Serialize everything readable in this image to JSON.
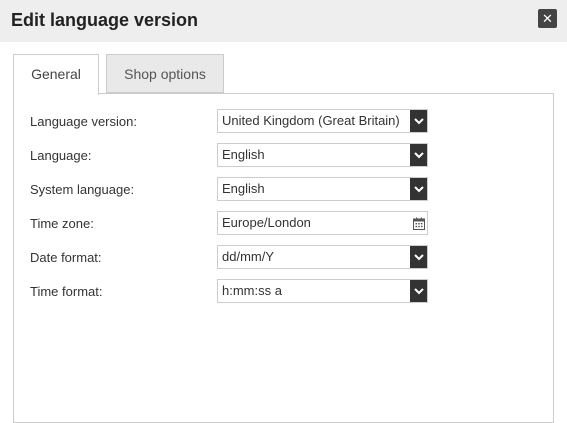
{
  "dialog": {
    "title": "Edit language version",
    "close_label": "✕"
  },
  "tabs": [
    {
      "label": "General",
      "active": true
    },
    {
      "label": "Shop options",
      "active": false
    }
  ],
  "form": {
    "language_version": {
      "label": "Language version:",
      "value": "United Kingdom (Great Britain)"
    },
    "language": {
      "label": "Language:",
      "value": "English"
    },
    "system_language": {
      "label": "System language:",
      "value": "English"
    },
    "time_zone": {
      "label": "Time zone:",
      "value": "Europe/London"
    },
    "date_format": {
      "label": "Date format:",
      "value": "dd/mm/Y"
    },
    "time_format": {
      "label": "Time format:",
      "value": "h:mm:ss a"
    }
  },
  "icons": {
    "close": "close-icon",
    "dropdown": "chevron-down-icon",
    "calendar": "calendar-icon"
  }
}
